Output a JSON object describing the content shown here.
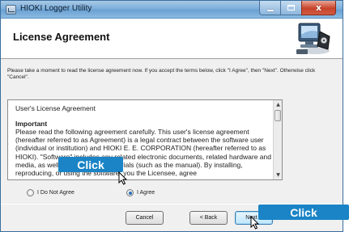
{
  "window": {
    "title": "HIOKI Logger Utility",
    "caption_min": "–",
    "caption_close": "x"
  },
  "header": {
    "title": "License Agreement"
  },
  "intro": {
    "text": "Please take a moment to read the license agreement now. If you accept the terms below, click \"I Agree\", then \"Next\". Otherwise click \"Cancel\"."
  },
  "license": {
    "title": "User's License Agreement",
    "heading": "Important",
    "body": "Please read the following agreement carefully. This user's license agreement (hereafter referred to as Agreement) is a legal contract between the software user (individual or institution) and HIOKI E. E. CORPORATION (hereafter referred to as HIOKI). \"Software\" includes any related electronic documents, related hardware and media, as well as any printed materials (such as the manual). By installing, reproducing, or using the software, you the Licensee, agree"
  },
  "radios": {
    "disagree_label": "I Do Not Agree",
    "agree_label": "I Agree",
    "selected": "agree"
  },
  "buttons": {
    "cancel": "Cancel",
    "back": "< Back",
    "next": "Next >"
  },
  "callouts": {
    "left": "Click",
    "right": "Click",
    "color": "#1a84c6"
  }
}
